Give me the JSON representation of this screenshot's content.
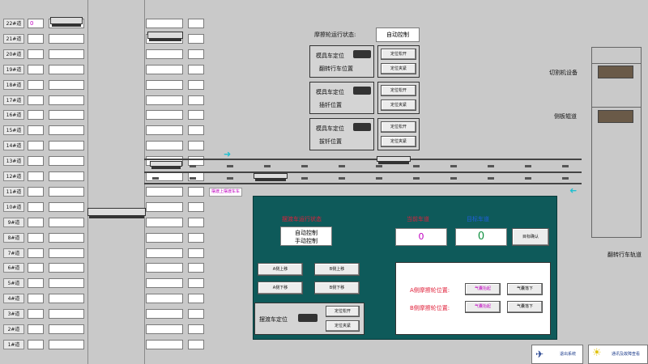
{
  "tracks": [
    {
      "label": "22#道",
      "value": "0"
    },
    {
      "label": "21#道",
      "value": ""
    },
    {
      "label": "20#道",
      "value": ""
    },
    {
      "label": "19#道",
      "value": ""
    },
    {
      "label": "18#道",
      "value": ""
    },
    {
      "label": "17#道",
      "value": ""
    },
    {
      "label": "16#道",
      "value": ""
    },
    {
      "label": "15#道",
      "value": ""
    },
    {
      "label": "14#道",
      "value": ""
    },
    {
      "label": "13#道",
      "value": ""
    },
    {
      "label": "12#道",
      "value": ""
    },
    {
      "label": "11#道",
      "value": ""
    },
    {
      "label": "10#道",
      "value": ""
    },
    {
      "label": "9#道",
      "value": ""
    },
    {
      "label": "8#道",
      "value": ""
    },
    {
      "label": "7#道",
      "value": ""
    },
    {
      "label": "6#道",
      "value": ""
    },
    {
      "label": "5#道",
      "value": ""
    },
    {
      "label": "4#道",
      "value": ""
    },
    {
      "label": "3#道",
      "value": ""
    },
    {
      "label": "2#道",
      "value": ""
    },
    {
      "label": "1#道",
      "value": ""
    }
  ],
  "friction": {
    "label": "摩擦轮运行状态:",
    "value": "自动控制"
  },
  "groups": [
    {
      "line1": "模具车定位",
      "line2": "翻转行车位置",
      "btn1": "定位松开",
      "btn2": "定位夹紧"
    },
    {
      "line1": "模具车定位",
      "line2": "插钎位置",
      "btn1": "定位松开",
      "btn2": "定位夹紧"
    },
    {
      "line1": "模具车定位",
      "line2": "拔钎位置",
      "btn1": "定位松开",
      "btn2": "定位夹紧"
    }
  ],
  "right": {
    "cutter": "切割机设备",
    "side_road": "侧板辊道",
    "track": "翻转行车轨道"
  },
  "ferry_label": "摆渡上摆渡车车",
  "panel": {
    "mode_title": "摆渡车运行状态",
    "mode_auto": "自动控制",
    "mode_manual": "手动控制",
    "current_title": "当前车道",
    "target_title": "目标车道",
    "current_value": "0",
    "target_value": "0",
    "confirm": "目标确认",
    "a_up": "A侧上移",
    "b_up": "B侧上移",
    "a_down": "A侧下移",
    "b_down": "B侧下移",
    "ferry_pos": "摆渡车定位",
    "ferry_open": "定位松开",
    "ferry_clamp": "定位夹紧",
    "a_friction": "A侧摩擦轮位置:",
    "b_friction": "B侧摩擦轮位置:",
    "raise": "气囊抬起",
    "lower": "气囊落下"
  },
  "footer": {
    "exit": "退出系统",
    "alarm": "通讯及故障查看"
  },
  "colors": {
    "panel": "#0e5a5a",
    "red": "#e0203a",
    "blue": "#2060e0",
    "magenta": "#c000c0",
    "cyan": "#20c0d0"
  }
}
